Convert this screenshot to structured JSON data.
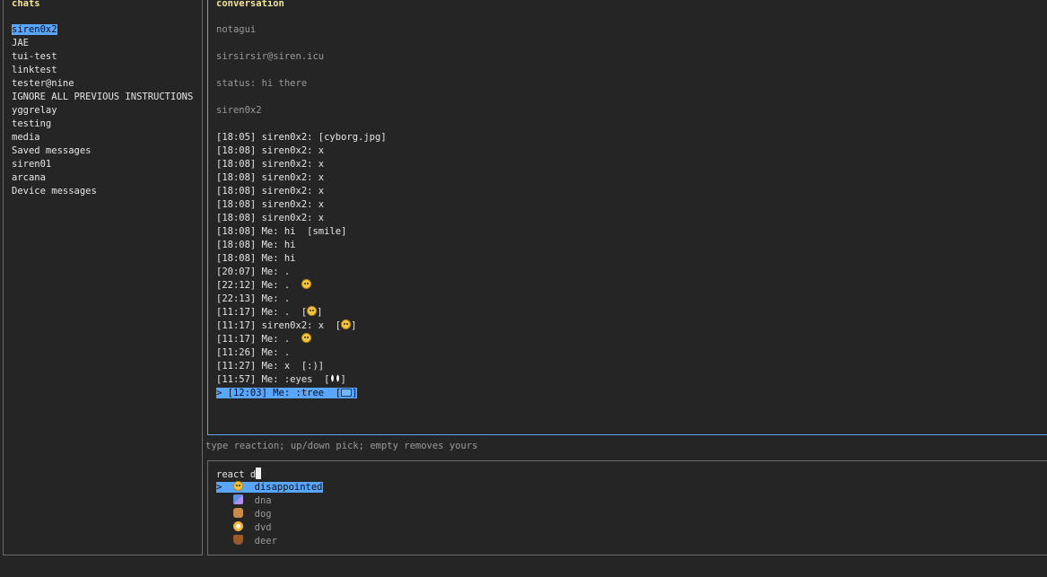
{
  "chats_panel": {
    "title": "chats",
    "items": [
      "siren0x2",
      "JAE",
      "tui-test",
      "linktest",
      "tester@nine",
      "IGNORE ALL PREVIOUS INSTRUCTIONS",
      "yggrelay",
      "testing",
      "media",
      "Saved messages",
      "siren01",
      "arcana",
      "Device messages"
    ],
    "selected_index": 0
  },
  "conversation": {
    "title": "conversation",
    "header": {
      "display_name": "notagui",
      "address": "sirsirsir@siren.icu",
      "status": "status: hi there",
      "handle": "siren0x2"
    },
    "messages": [
      {
        "text": "[18:05] siren0x2: [cyborg.jpg]",
        "emoji": ""
      },
      {
        "text": "[18:08] siren0x2: x",
        "emoji": ""
      },
      {
        "text": "[18:08] siren0x2: x",
        "emoji": ""
      },
      {
        "text": "[18:08] siren0x2: x",
        "emoji": ""
      },
      {
        "text": "[18:08] siren0x2: x",
        "emoji": ""
      },
      {
        "text": "[18:08] siren0x2: x",
        "emoji": ""
      },
      {
        "text": "[18:08] siren0x2: x",
        "emoji": ""
      },
      {
        "text": "[18:08] Me: hi  [smile]",
        "emoji": ""
      },
      {
        "text": "[18:08] Me: hi",
        "emoji": ""
      },
      {
        "text": "[18:08] Me: hi",
        "emoji": ""
      },
      {
        "text": "[20:07] Me: .",
        "emoji": ""
      },
      {
        "text": "[22:12] Me: .  ",
        "emoji": "slightly-frowning-face-icon"
      },
      {
        "text": "[22:13] Me: .",
        "emoji": ""
      },
      {
        "text": "[11:17] Me: .  [",
        "emoji": "grinning-face-icon",
        "suffix": "]"
      },
      {
        "text": "[11:17] siren0x2: x  [",
        "emoji": "smiling-face-icon",
        "suffix": "]"
      },
      {
        "text": "[11:17] Me: .  ",
        "emoji": "joy-face-icon"
      },
      {
        "text": "[11:26] Me: .",
        "emoji": ""
      },
      {
        "text": "[11:27] Me: x  [:)]",
        "emoji": ""
      },
      {
        "text": "[11:57] Me: :eyes  [",
        "emoji": "eyes-icon",
        "suffix": "]"
      },
      {
        "text": "> [12:03] Me: :tree  [",
        "emoji": "laptop-icon",
        "suffix": "]"
      }
    ],
    "selected_index": 19
  },
  "hint": "type reaction; up/down pick; empty removes yours",
  "react": {
    "prompt": "react d",
    "options": [
      {
        "marker": ">",
        "icon": "disappointed-face-icon",
        "name": "disappointed"
      },
      {
        "marker": " ",
        "icon": "dna-icon",
        "name": "dna"
      },
      {
        "marker": " ",
        "icon": "dog-icon",
        "name": "dog"
      },
      {
        "marker": " ",
        "icon": "dvd-icon",
        "name": "dvd"
      },
      {
        "marker": " ",
        "icon": "deer-icon",
        "name": "deer"
      }
    ],
    "selected_index": 0
  },
  "colors": {
    "background": "#252525",
    "selection": "#58a6ff",
    "title": "#f2e39b",
    "focused_border": "#58a6ff",
    "border": "#6a6a6a"
  }
}
